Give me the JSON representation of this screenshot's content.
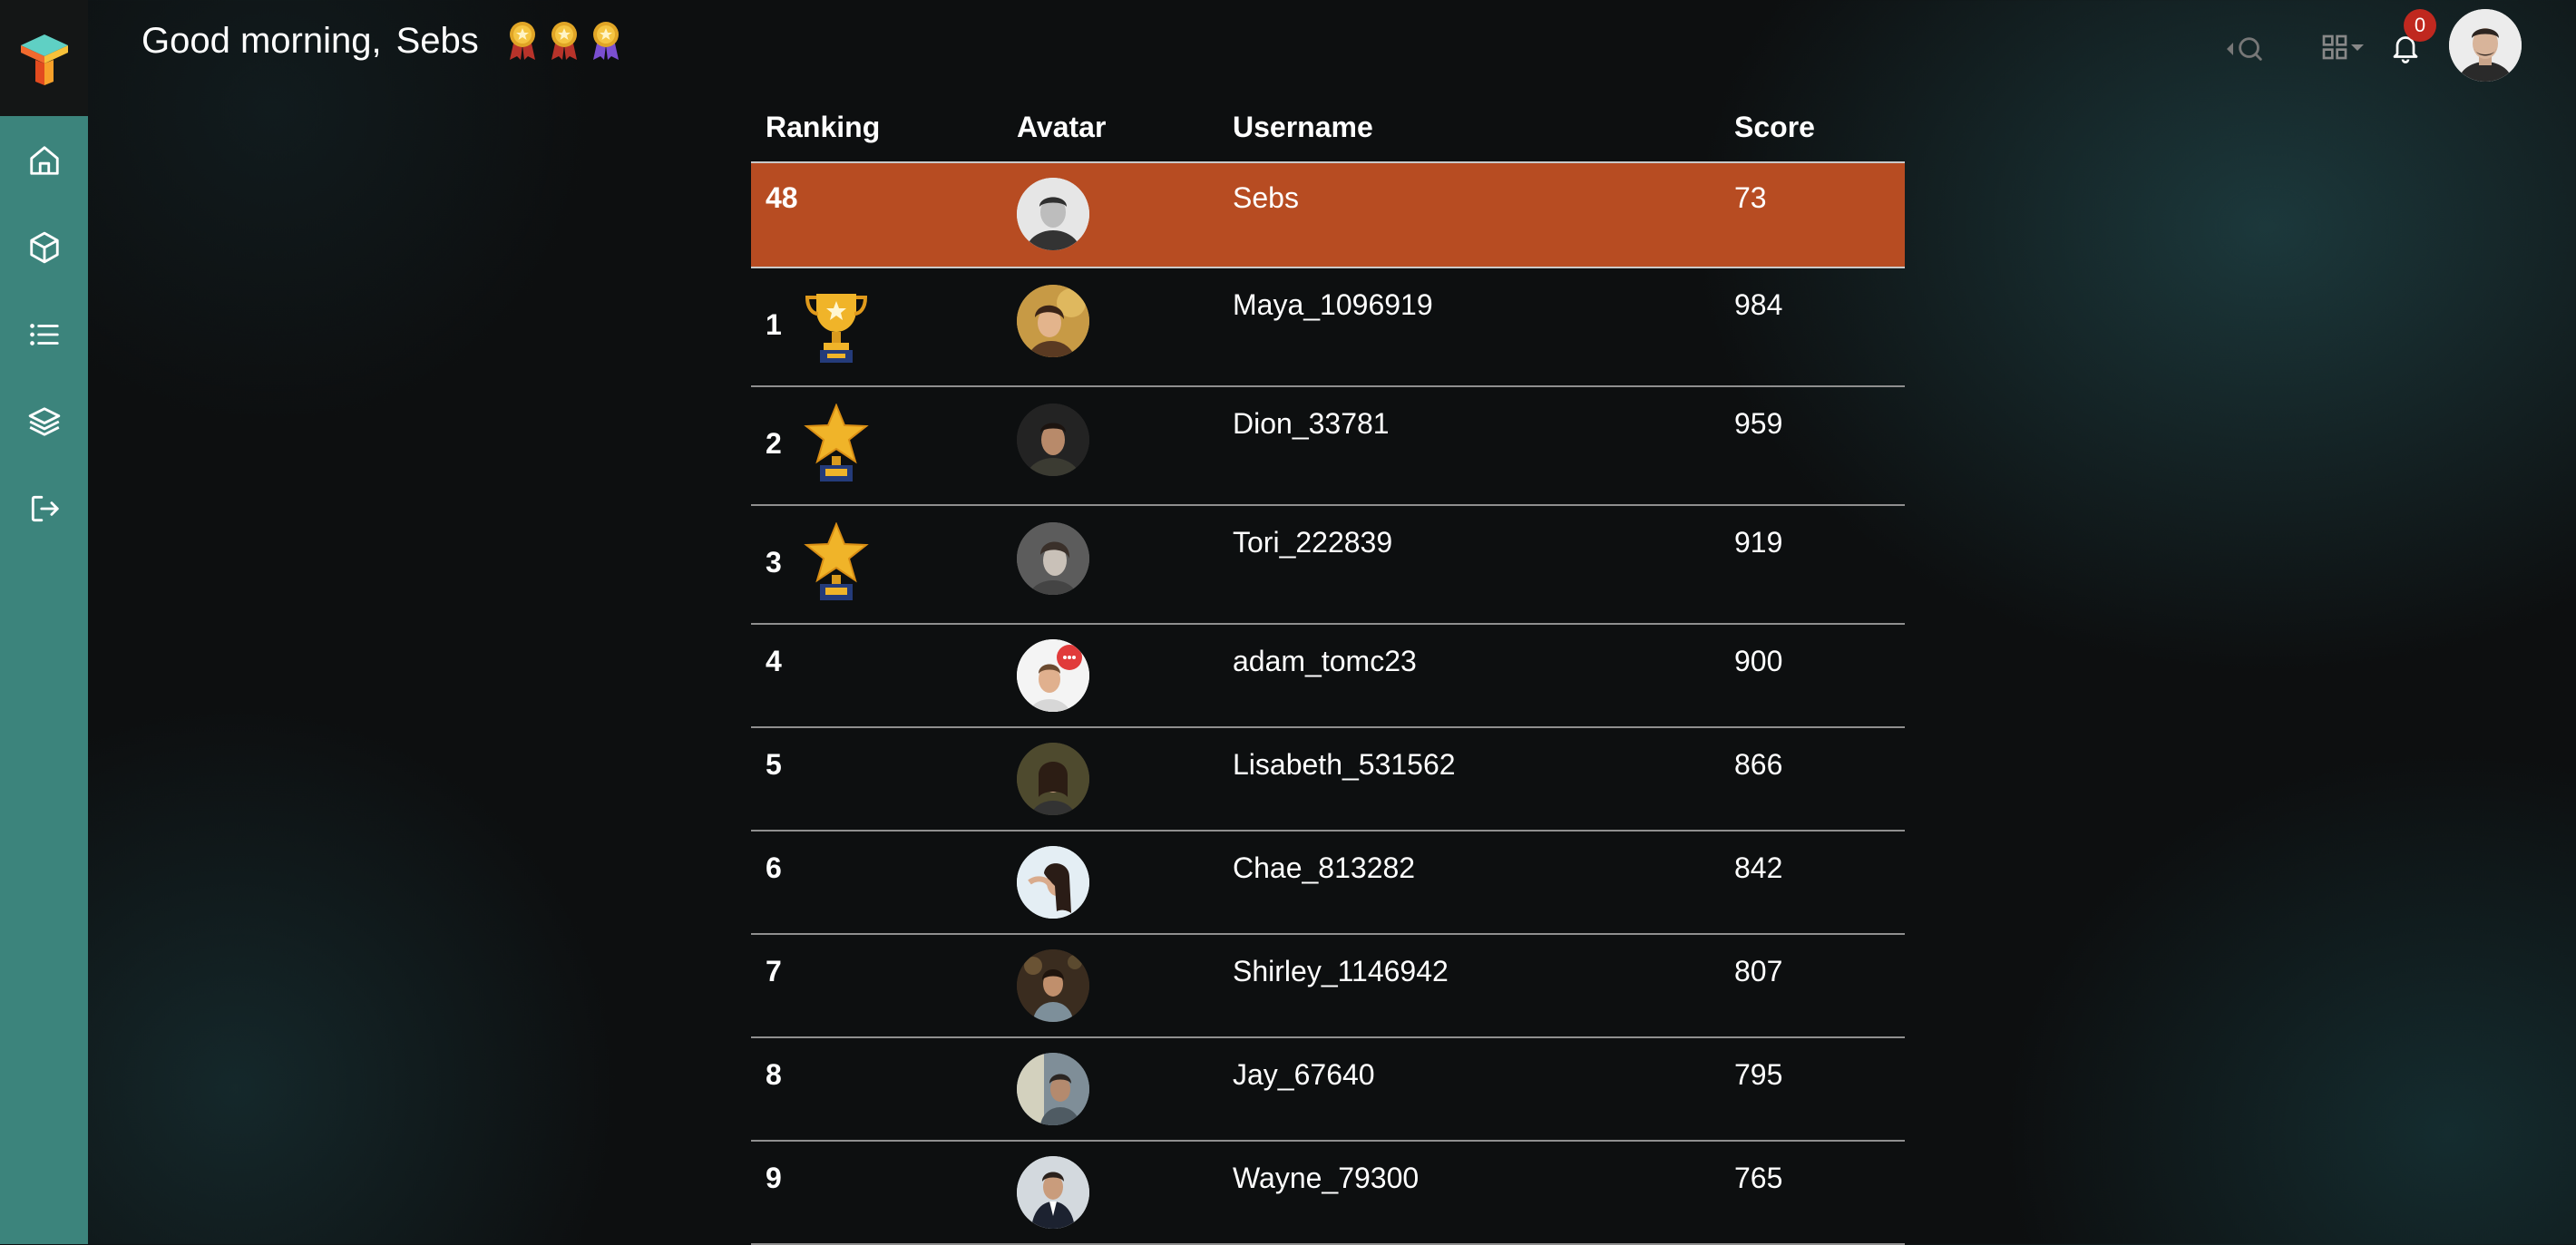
{
  "header": {
    "greeting": "Good morning,",
    "username": "Sebs",
    "notification_count": "0"
  },
  "sidebar": {
    "items": [
      {
        "icon": "home-icon"
      },
      {
        "icon": "box-icon"
      },
      {
        "icon": "list-icon"
      },
      {
        "icon": "layers-icon"
      },
      {
        "icon": "logout-icon"
      }
    ]
  },
  "leaderboard": {
    "columns": [
      "Ranking",
      "Avatar",
      "Username",
      "Score"
    ],
    "current_user": {
      "rank": "48",
      "username": "Sebs",
      "score": "73"
    },
    "rows": [
      {
        "rank": "1",
        "username": "Maya_1096919",
        "score": "984"
      },
      {
        "rank": "2",
        "username": "Dion_33781",
        "score": "959"
      },
      {
        "rank": "3",
        "username": "Tori_222839",
        "score": "919"
      },
      {
        "rank": "4",
        "username": "adam_tomc23",
        "score": "900"
      },
      {
        "rank": "5",
        "username": "Lisabeth_531562",
        "score": "866"
      },
      {
        "rank": "6",
        "username": "Chae_813282",
        "score": "842"
      },
      {
        "rank": "7",
        "username": "Shirley_1146942",
        "score": "807"
      },
      {
        "rank": "8",
        "username": "Jay_67640",
        "score": "795"
      },
      {
        "rank": "9",
        "username": "Wayne_79300",
        "score": "765"
      }
    ]
  },
  "colors": {
    "sidebar": "#3c847c",
    "highlight_row": "#b74c22",
    "notification_badge": "#c0281f"
  }
}
